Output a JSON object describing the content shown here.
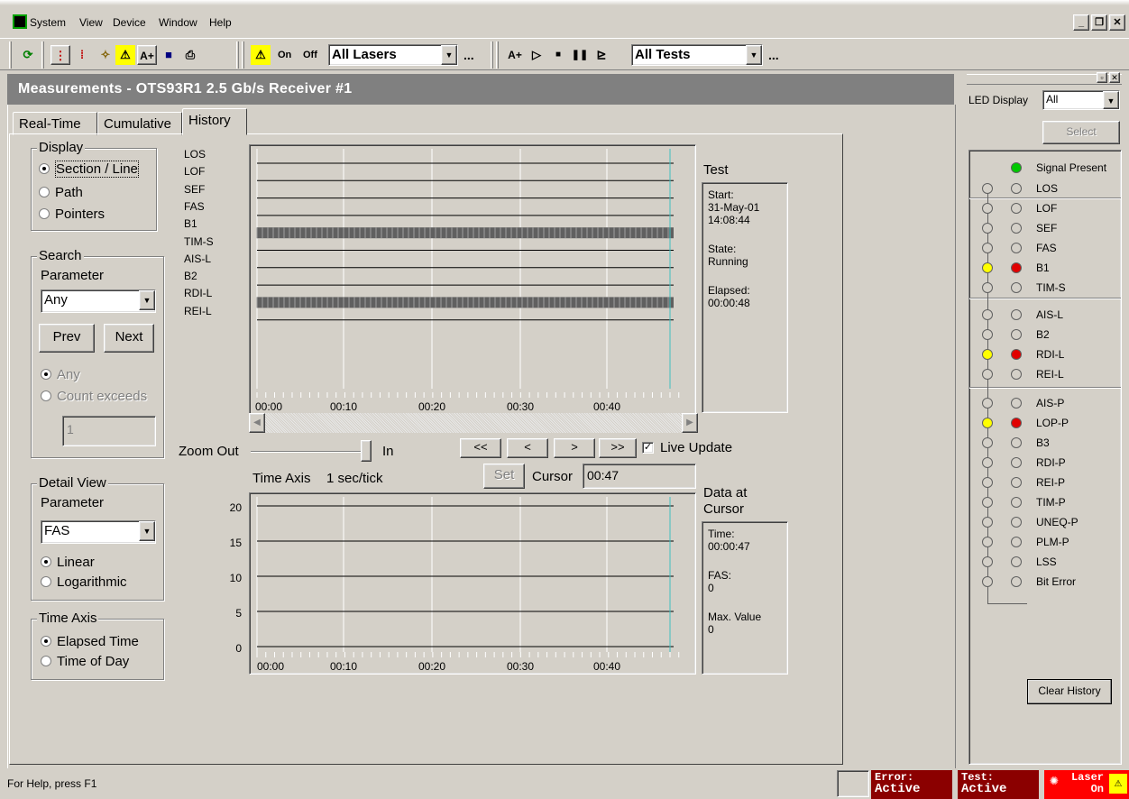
{
  "menu": {
    "items": [
      "System",
      "View",
      "Device",
      "Window",
      "Help"
    ]
  },
  "toolbar": {
    "on_label": "On",
    "off_label": "Off",
    "lasers_select": "All Lasers",
    "tests_select": "All Tests",
    "more": "...",
    "aplus": "A+",
    "aplus2": "A+"
  },
  "window": {
    "title": "Measurements - OTS93R1 2.5 Gb/s Receiver #1"
  },
  "tabs": [
    "Real-Time",
    "Cumulative",
    "History"
  ],
  "display": {
    "title": "Display",
    "options": [
      "Section / Line",
      "Path",
      "Pointers"
    ]
  },
  "search": {
    "title": "Search",
    "param_label": "Parameter",
    "param_value": "Any",
    "prev": "Prev",
    "next": "Next",
    "options": [
      "Any",
      "Count exceeds"
    ],
    "count_value": "1"
  },
  "detail": {
    "title": "Detail View",
    "param_label": "Parameter",
    "param_value": "FAS",
    "options": [
      "Linear",
      "Logarithmic"
    ]
  },
  "timeaxis": {
    "title": "Time Axis",
    "options": [
      "Elapsed Time",
      "Time of Day"
    ]
  },
  "history": {
    "row_labels": [
      "LOS",
      "LOF",
      "SEF",
      "FAS",
      "B1",
      "TIM-S",
      "AIS-L",
      "B2",
      "RDI-L",
      "REI-L"
    ],
    "x_ticks": [
      "00:00",
      "00:10",
      "00:20",
      "00:30",
      "00:40"
    ],
    "active_rows": [
      "B1",
      "RDI-L"
    ]
  },
  "test": {
    "title": "Test",
    "start_label": "Start:",
    "start_date": "31-May-01",
    "start_time": "14:08:44",
    "state_label": "State:",
    "state_value": "Running",
    "elapsed_label": "Elapsed:",
    "elapsed_value": "00:00:48"
  },
  "zoom": {
    "out_label": "Zoom Out",
    "in_label": "In",
    "nav": [
      "<<",
      "<",
      ">",
      ">>"
    ],
    "live_update": "Live Update",
    "time_axis_label": "Time Axis",
    "tick_label": "1 sec/tick",
    "set": "Set",
    "cursor_label": "Cursor",
    "cursor_value": "00:47"
  },
  "chart_data": {
    "type": "line",
    "title": "",
    "y_ticks": [
      "20",
      "15",
      "10",
      "5",
      "0"
    ],
    "ylim": [
      0,
      20
    ],
    "x_ticks": [
      "00:00",
      "00:10",
      "00:20",
      "00:30",
      "00:40"
    ],
    "series": [
      {
        "values": [
          0,
          0,
          0,
          0,
          0
        ]
      }
    ],
    "cursor_at": "00:47"
  },
  "cursor_data": {
    "title1": "Data at",
    "title2": "Cursor",
    "time_label": "Time:",
    "time_value": "00:00:47",
    "fas_label": "FAS:",
    "fas_value": "0",
    "max_label": "Max. Value",
    "max_value": "0"
  },
  "led": {
    "display_label": "LED Display",
    "display_value": "All",
    "select": "Select",
    "clear": "Clear History",
    "items": [
      {
        "name": "Signal Present",
        "state": "green",
        "hist": ""
      },
      {
        "name": "LOS",
        "state": "off",
        "hist": "off"
      },
      {
        "name": "LOF",
        "state": "off",
        "hist": "off"
      },
      {
        "name": "SEF",
        "state": "off",
        "hist": "off"
      },
      {
        "name": "FAS",
        "state": "off",
        "hist": "off"
      },
      {
        "name": "B1",
        "state": "red",
        "hist": "yellow"
      },
      {
        "name": "TIM-S",
        "state": "off",
        "hist": "off"
      },
      {
        "name": "AIS-L",
        "state": "off",
        "hist": "off"
      },
      {
        "name": "B2",
        "state": "off",
        "hist": "off"
      },
      {
        "name": "RDI-L",
        "state": "red",
        "hist": "yellow"
      },
      {
        "name": "REI-L",
        "state": "off",
        "hist": "off"
      },
      {
        "name": "AIS-P",
        "state": "off",
        "hist": "off"
      },
      {
        "name": "LOP-P",
        "state": "red",
        "hist": "yellow"
      },
      {
        "name": "B3",
        "state": "off",
        "hist": "off"
      },
      {
        "name": "RDI-P",
        "state": "off",
        "hist": "off"
      },
      {
        "name": "REI-P",
        "state": "off",
        "hist": "off"
      },
      {
        "name": "TIM-P",
        "state": "off",
        "hist": "off"
      },
      {
        "name": "UNEQ-P",
        "state": "off",
        "hist": "off"
      },
      {
        "name": "PLM-P",
        "state": "off",
        "hist": "off"
      },
      {
        "name": "LSS",
        "state": "off",
        "hist": "off"
      },
      {
        "name": "Bit Error",
        "state": "off",
        "hist": "off"
      }
    ]
  },
  "status": {
    "help": "For Help, press F1",
    "error1": "Error:",
    "error2": "Active",
    "test1": "Test:",
    "test2": "Active",
    "laser1": "Laser",
    "laser2": "On"
  },
  "colors": {
    "green": "#00c800",
    "red": "#e00000",
    "yellow": "#ffff00",
    "cursor_line": "#40c0c0",
    "status_red": "#8b0000"
  }
}
